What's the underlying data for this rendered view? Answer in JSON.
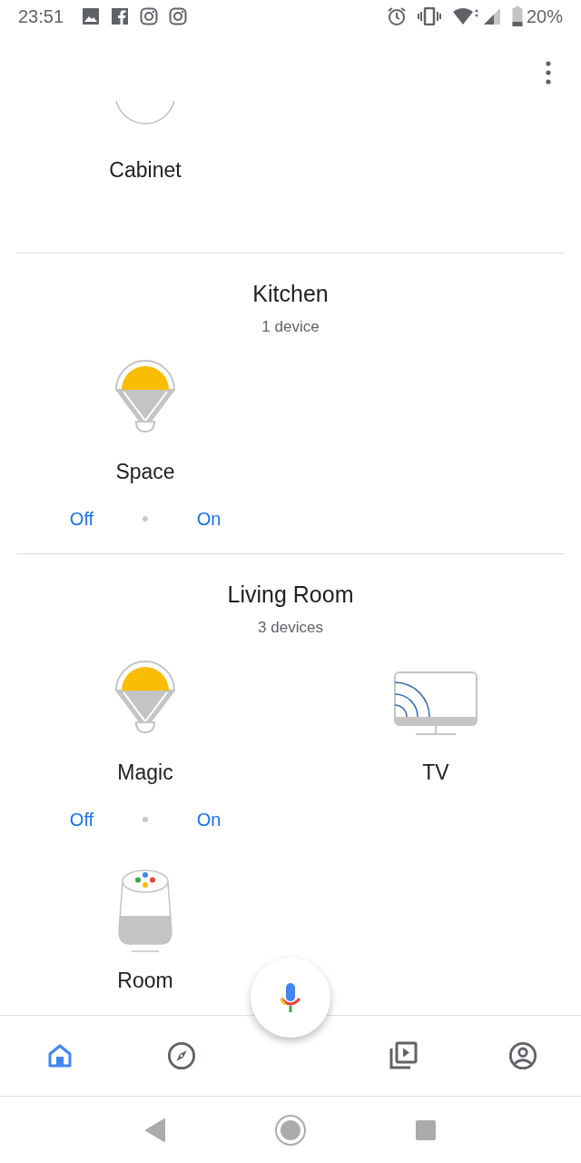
{
  "status_bar": {
    "time": "23:51",
    "battery": "20%"
  },
  "rooms": [
    {
      "devices": [
        {
          "kind": "cut",
          "name": "Cabinet"
        }
      ]
    },
    {
      "name": "Kitchen",
      "count": "1 device",
      "devices": [
        {
          "kind": "bulb",
          "name": "Space",
          "off": "Off",
          "on": "On"
        }
      ]
    },
    {
      "name": "Living Room",
      "count": "3 devices",
      "devices": [
        {
          "kind": "bulb",
          "name": "Magic",
          "off": "Off",
          "on": "On"
        },
        {
          "kind": "tv",
          "name": "TV"
        },
        {
          "kind": "speaker",
          "name": "Room"
        }
      ]
    }
  ],
  "bottom_nav": [
    {
      "kind": "home",
      "selected": true
    },
    {
      "kind": "discover",
      "selected": false
    },
    {
      "kind": "media",
      "selected": false
    },
    {
      "kind": "account",
      "selected": false
    }
  ]
}
